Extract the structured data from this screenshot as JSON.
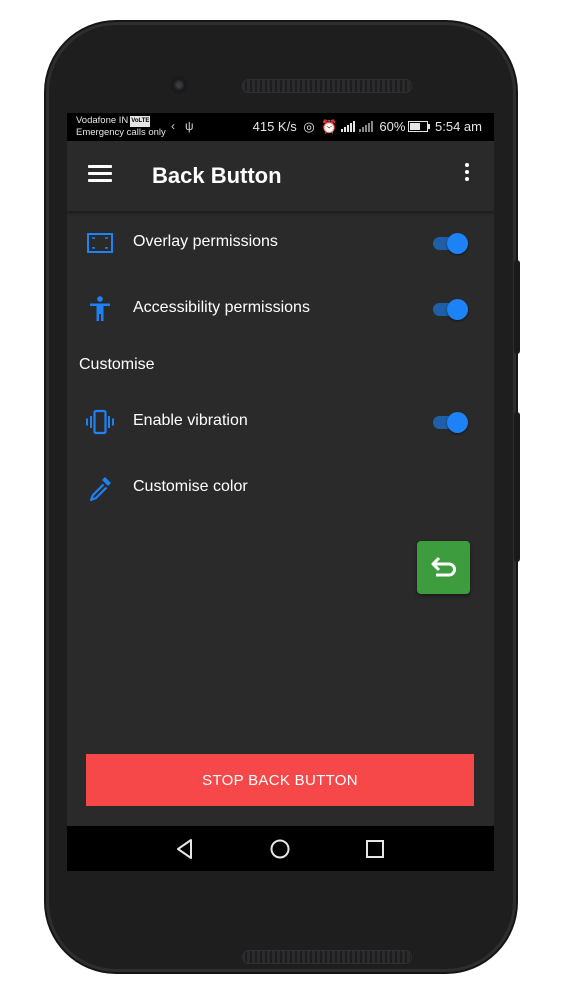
{
  "status_bar": {
    "carrier": "Vodafone IN",
    "volte": "VoLTE",
    "emergency": "Emergency calls only",
    "speed": "415 K/s",
    "battery": "60%",
    "time": "5:54 am"
  },
  "toolbar": {
    "title": "Back Button"
  },
  "settings": {
    "overlay_label": "Overlay permissions",
    "overlay_enabled": true,
    "accessibility_label": "Accessibility permissions",
    "accessibility_enabled": true,
    "section_customise": "Customise",
    "vibration_label": "Enable vibration",
    "vibration_enabled": true,
    "color_label": "Customise color"
  },
  "actions": {
    "stop_label": "STOP BACK BUTTON"
  },
  "icons": {
    "menu": "menu-icon",
    "more": "more-vert-icon",
    "overlay": "overlay-icon",
    "accessibility": "accessibility-icon",
    "vibration": "vibration-icon",
    "color": "eyedropper-icon",
    "back": "back-arrow-icon",
    "nav_back": "nav-back-icon",
    "nav_home": "nav-home-icon",
    "nav_recents": "nav-recents-icon"
  },
  "colors": {
    "accent": "#1c82f5",
    "stop_button": "#f64848",
    "fab": "#3d9c3e",
    "background": "#2a2a2b"
  }
}
